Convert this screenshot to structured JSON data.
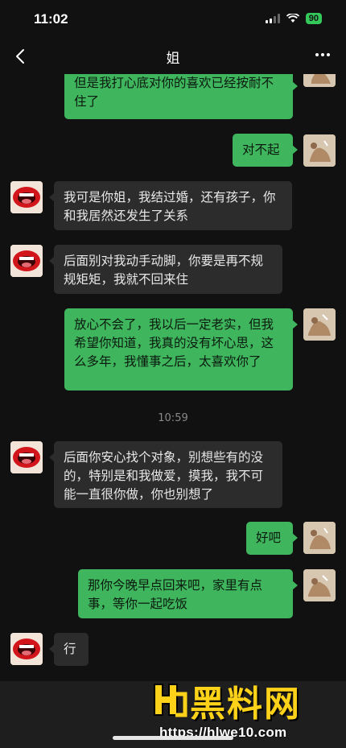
{
  "status_bar": {
    "time": "11:02",
    "battery": "90"
  },
  "header": {
    "title": "姐"
  },
  "messages": [
    {
      "from": "self",
      "text": "但是我打心底对你的喜欢已经按耐不住了"
    },
    {
      "from": "self",
      "text": "对不起"
    },
    {
      "from": "other",
      "text": "我可是你姐，我结过婚，还有孩子，你和我居然还发生了关系"
    },
    {
      "from": "other",
      "text": "后面别对我动手动脚，你要是再不规规矩矩，我就不回来住"
    },
    {
      "from": "self",
      "text": "放心不会了，我以后一定老实，但我希望你知道，我真的没有坏心思，这么多年，我懂事之后，太喜欢你了"
    },
    {
      "from": "other",
      "text": "后面你安心找个对象，别想些有的没的，特别是和我做爱，摸我，我不可能一直很你做，你也别想了"
    },
    {
      "from": "self",
      "text": "好吧"
    },
    {
      "from": "self",
      "text": "那你今晚早点回来吧，家里有点事，等你一起吃饭"
    },
    {
      "from": "other",
      "text": "行"
    }
  ],
  "timestamp": "10:59",
  "watermark": {
    "brand": "黑料网",
    "url": "https://hlwe10.com"
  },
  "icons": [
    "signal-icon",
    "wifi-icon",
    "battery-icon",
    "back-chevron-icon",
    "more-icon"
  ]
}
